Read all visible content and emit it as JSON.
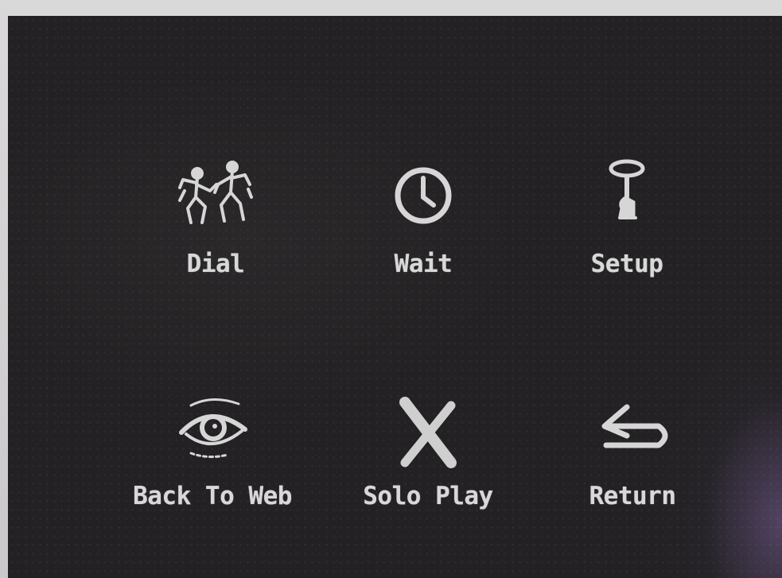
{
  "menu": {
    "items": [
      {
        "label": "Dial",
        "icon": "dancing-figures-icon"
      },
      {
        "label": "Wait",
        "icon": "clock-icon"
      },
      {
        "label": "Setup",
        "icon": "key-icon"
      },
      {
        "label": "Back To Web",
        "icon": "eye-icon"
      },
      {
        "label": "Solo Play",
        "icon": "x-cross-icon"
      },
      {
        "label": "Return",
        "icon": "return-arrow-icon"
      }
    ]
  },
  "colors": {
    "screen_background": "#242224",
    "foreground": "#d8d8d8",
    "frame": "#cfcfcf"
  }
}
